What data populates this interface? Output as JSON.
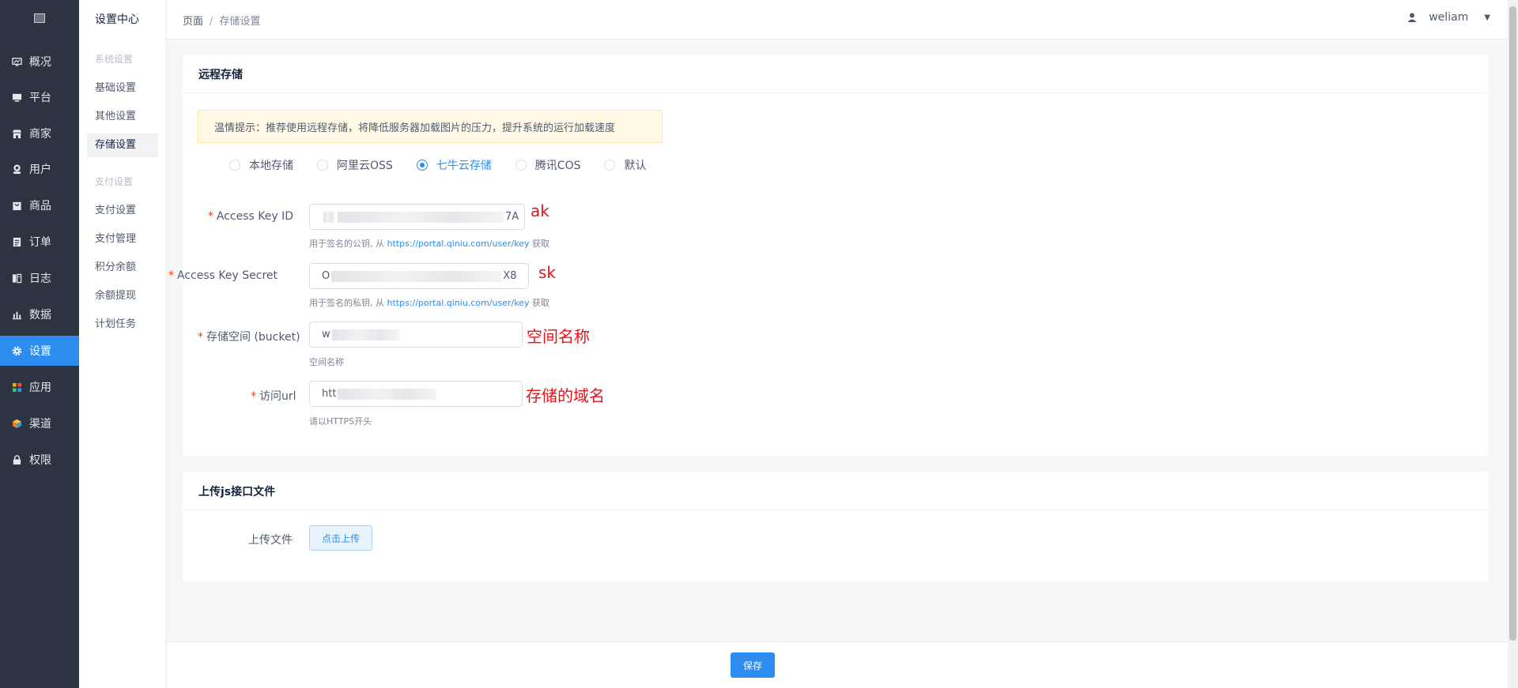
{
  "nav": {
    "items": [
      {
        "label": "概况",
        "icon": "monitor-chart-icon"
      },
      {
        "label": "平台",
        "icon": "desktop-icon"
      },
      {
        "label": "商家",
        "icon": "store-icon"
      },
      {
        "label": "用户",
        "icon": "user-icon"
      },
      {
        "label": "商品",
        "icon": "bag-icon"
      },
      {
        "label": "订单",
        "icon": "order-icon"
      },
      {
        "label": "日志",
        "icon": "log-icon"
      },
      {
        "label": "数据",
        "icon": "bar-chart-icon"
      },
      {
        "label": "设置",
        "icon": "gear-icon"
      },
      {
        "label": "应用",
        "icon": "apps-grid-icon"
      },
      {
        "label": "渠道",
        "icon": "cube-icon"
      },
      {
        "label": "权限",
        "icon": "lock-icon"
      }
    ],
    "active_index": 8
  },
  "submenu": {
    "title": "设置中心",
    "group1": "系统设置",
    "group1_items": [
      "基础设置",
      "其他设置",
      "存储设置"
    ],
    "group2": "支付设置",
    "group2_items": [
      "支付设置",
      "支付管理",
      "积分余额",
      "余额提现",
      "计划任务"
    ]
  },
  "topbar": {
    "crumb_root": "页面",
    "crumb_sep": "/",
    "crumb_current": "存储设置",
    "username": "weliam"
  },
  "remote": {
    "title": "远程存储",
    "tip": "温情提示：推荐使用远程存储，将降低服务器加载图片的压力，提升系统的运行加载速度",
    "options": [
      "本地存储",
      "阿里云OSS",
      "七牛云存储",
      "腾讯COS",
      "默认"
    ],
    "selected_index": 2,
    "fields": {
      "ak_label": "Access Key ID",
      "ak_prefix": "",
      "ak_suffix": "7A",
      "ak_help_prefix": "用于签名的公钥, 从",
      "ak_help_link": "https://portal.qiniu.com/user/key",
      "ak_help_suffix": "获取",
      "sk_label": "Access Key Secret",
      "sk_prefix": "O",
      "sk_suffix": "X8",
      "sk_help_prefix": "用于签名的私钥, 从",
      "sk_help_link": "https://portal.qiniu.com/user/key",
      "sk_help_suffix": "获取",
      "bucket_label": "存储空间 (bucket)",
      "bucket_prefix": "w",
      "bucket_help": "空间名称",
      "url_label": "访问url",
      "url_prefix": "htt",
      "url_help": "请以HTTPS开头"
    },
    "annotations": {
      "ak": "ak",
      "sk": "sk",
      "bucket": "空间名称",
      "url": "存储的域名"
    }
  },
  "upload": {
    "title": "上传js接口文件",
    "label": "上传文件",
    "button": "点击上传"
  },
  "footer": {
    "save": "保存"
  },
  "colors": {
    "nav_bg": "#2c3442",
    "accent": "#2d8cf0",
    "annotation": "#e5141a"
  }
}
